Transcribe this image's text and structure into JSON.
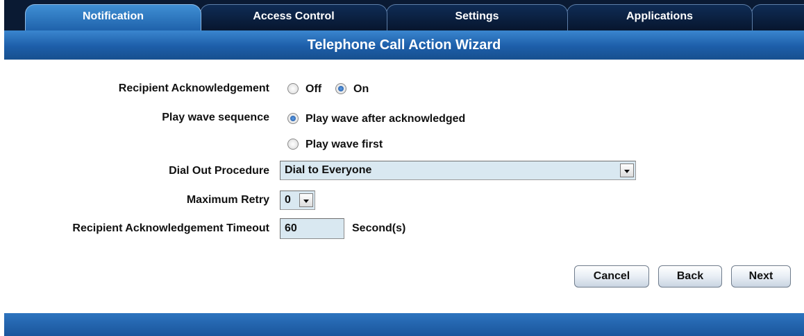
{
  "tabs": [
    {
      "label": "Notification",
      "active": true
    },
    {
      "label": "Access Control",
      "active": false
    },
    {
      "label": "Settings",
      "active": false
    },
    {
      "label": "Applications",
      "active": false
    }
  ],
  "title": "Telephone Call Action Wizard",
  "form": {
    "ack_label": "Recipient Acknowledgement",
    "ack_options": [
      {
        "label": "Off",
        "selected": false
      },
      {
        "label": "On",
        "selected": true
      }
    ],
    "wave_label": "Play wave sequence",
    "wave_options": [
      {
        "label": "Play wave after acknowledged",
        "selected": true
      },
      {
        "label": "Play wave first",
        "selected": false
      }
    ],
    "dial_label": "Dial Out Procedure",
    "dial_value": "Dial to Everyone",
    "retry_label": "Maximum Retry",
    "retry_value": "0",
    "timeout_label": "Recipient Acknowledgement Timeout",
    "timeout_value": "60",
    "timeout_unit": "Second(s)"
  },
  "buttons": {
    "cancel": "Cancel",
    "back": "Back",
    "next": "Next"
  },
  "colors": {
    "tab_active": "#2f7fc8",
    "title_bar": "#1d5ea9",
    "field_bg": "#d9e8f1"
  }
}
